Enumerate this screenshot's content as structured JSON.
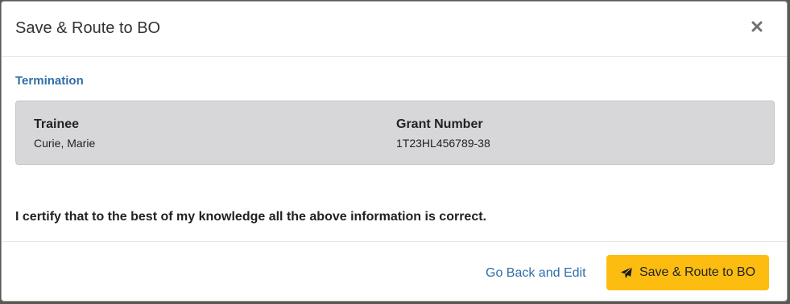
{
  "modal": {
    "title": "Save & Route to BO",
    "close_icon": "close-icon"
  },
  "body": {
    "section_link": "Termination",
    "trainee_label": "Trainee",
    "trainee_value": "Curie, Marie",
    "grant_label": "Grant Number",
    "grant_value": "1T23HL456789-38",
    "certify_text": "I certify that to the best of my knowledge all the above information is correct."
  },
  "footer": {
    "back_link": "Go Back and Edit",
    "primary_button": "Save & Route to BO",
    "primary_icon": "paper-plane-icon"
  },
  "colors": {
    "accent": "#fdbd10",
    "link": "#2f6ea8",
    "panel": "#d7d7d9"
  }
}
